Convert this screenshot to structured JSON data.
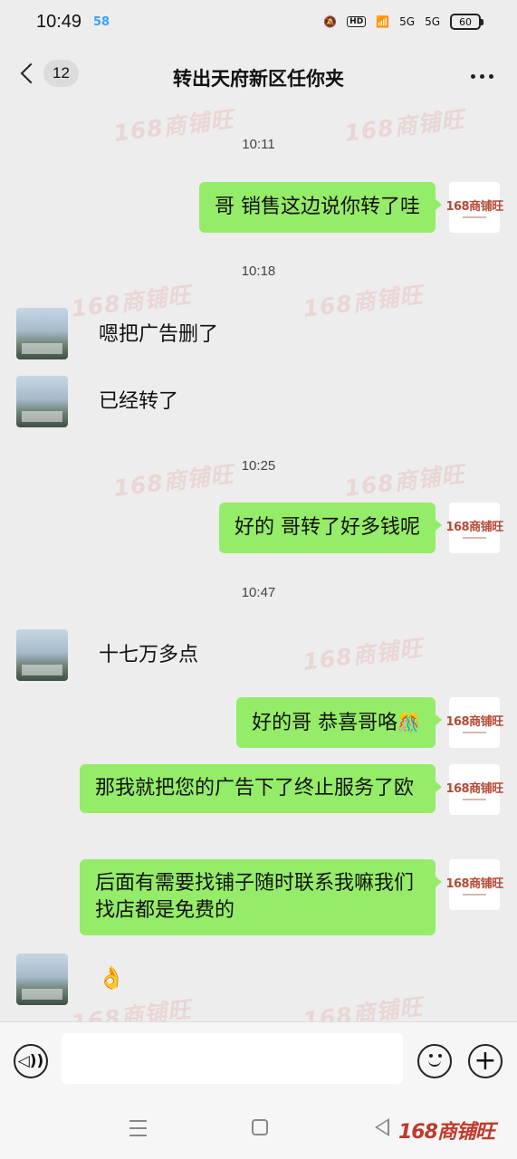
{
  "status_bar": {
    "time": "10:49",
    "app_badge": "58",
    "hd_label": "HD",
    "signal_1": "5G",
    "signal_2": "5G",
    "battery": "60"
  },
  "header": {
    "unread_count": "12",
    "title": "转出天府新区任你夹"
  },
  "watermark_text": "168商铺旺",
  "avatar_logo_text": "168商铺旺",
  "messages": [
    {
      "kind": "time",
      "text": "10:11"
    },
    {
      "kind": "out",
      "text": "哥 销售这边说你转了哇"
    },
    {
      "kind": "time",
      "text": "10:18"
    },
    {
      "kind": "in",
      "text": "嗯把广告删了"
    },
    {
      "kind": "in",
      "text": "已经转了"
    },
    {
      "kind": "time",
      "text": "10:25"
    },
    {
      "kind": "out",
      "text": "好的 哥转了好多钱呢"
    },
    {
      "kind": "time",
      "text": "10:47"
    },
    {
      "kind": "in",
      "text": "十七万多点"
    },
    {
      "kind": "out",
      "text": "好的哥 恭喜哥咯",
      "emoji": "🎊"
    },
    {
      "kind": "out",
      "text": "那我就把您的广告下了终止服务了欧"
    },
    {
      "kind": "out",
      "text": "后面有需要找铺子随时联系我嘛我们找店都是免费的"
    },
    {
      "kind": "in",
      "emoji": "👌"
    }
  ],
  "input": {
    "value": "",
    "placeholder": ""
  },
  "corner_logo": "168商铺旺",
  "colors": {
    "outgoing_bubble": "#95ec69",
    "background": "#ededed"
  },
  "icons": [
    "voice-icon",
    "emoji-icon",
    "plus-icon",
    "back-chevron-icon",
    "more-icon"
  ]
}
